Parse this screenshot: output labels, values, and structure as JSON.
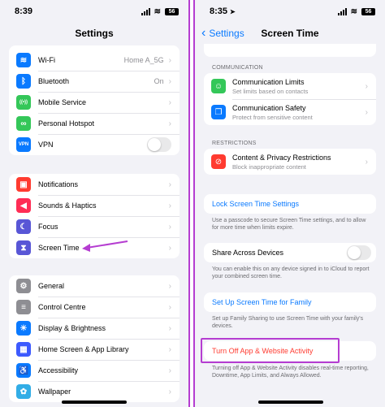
{
  "left": {
    "status_time": "8:39",
    "battery": "56",
    "title": "Settings",
    "group1": [
      {
        "label": "Wi-Fi",
        "value": "Home A_5G",
        "icon": "wifi-icon",
        "color": "#0a7aff",
        "glyph": "≋"
      },
      {
        "label": "Bluetooth",
        "value": "On",
        "icon": "bluetooth-icon",
        "color": "#0a7aff",
        "glyph": "ᛒ"
      },
      {
        "label": "Mobile Service",
        "value": "",
        "icon": "antenna-icon",
        "color": "#34c759",
        "glyph": "((•))"
      },
      {
        "label": "Personal Hotspot",
        "value": "",
        "icon": "hotspot-icon",
        "color": "#34c759",
        "glyph": "∞"
      },
      {
        "label": "VPN",
        "value": "",
        "icon": "vpn-icon",
        "color": "#0a7aff",
        "glyph": "VPN"
      }
    ],
    "group2": [
      {
        "label": "Notifications",
        "icon": "notifications-icon",
        "color": "#ff3b30",
        "glyph": "▣"
      },
      {
        "label": "Sounds & Haptics",
        "icon": "speaker-icon",
        "color": "#ff2d55",
        "glyph": "◀"
      },
      {
        "label": "Focus",
        "icon": "moon-icon",
        "color": "#5856d6",
        "glyph": "☾"
      },
      {
        "label": "Screen Time",
        "icon": "hourglass-icon",
        "color": "#5856d6",
        "glyph": "⧗"
      }
    ],
    "group3": [
      {
        "label": "General",
        "icon": "gear-icon",
        "color": "#8e8e93",
        "glyph": "⚙"
      },
      {
        "label": "Control Centre",
        "icon": "control-centre-icon",
        "color": "#8e8e93",
        "glyph": "≡"
      },
      {
        "label": "Display & Brightness",
        "icon": "sun-icon",
        "color": "#0a7aff",
        "glyph": "☀"
      },
      {
        "label": "Home Screen & App Library",
        "icon": "home-screen-icon",
        "color": "#3d5afe",
        "glyph": "▦"
      },
      {
        "label": "Accessibility",
        "icon": "accessibility-icon",
        "color": "#0a7aff",
        "glyph": "♿"
      },
      {
        "label": "Wallpaper",
        "icon": "wallpaper-icon",
        "color": "#32ade6",
        "glyph": "✿"
      }
    ]
  },
  "right": {
    "status_time": "8:35",
    "battery": "56",
    "back_label": "Settings",
    "title": "Screen Time",
    "communication_header": "COMMUNICATION",
    "communication": [
      {
        "title": "Communication Limits",
        "subtitle": "Set limits based on contacts",
        "icon": "contact-icon",
        "color": "#34c759",
        "glyph": "☺"
      },
      {
        "title": "Communication Safety",
        "subtitle": "Protect from sensitive content",
        "icon": "chat-bubble-icon",
        "color": "#0a7aff",
        "glyph": "❐"
      }
    ],
    "restrictions_header": "RESTRICTIONS",
    "restrictions": [
      {
        "title": "Content & Privacy Restrictions",
        "subtitle": "Block inappropriate content",
        "icon": "block-icon",
        "color": "#ff3b30",
        "glyph": "⊘"
      }
    ],
    "lock_label": "Lock Screen Time Settings",
    "lock_note": "Use a passcode to secure Screen Time settings, and to allow for more time when limits expire.",
    "share_label": "Share Across Devices",
    "share_note": "You can enable this on any device signed in to iCloud to report your combined screen time.",
    "family_label": "Set Up Screen Time for Family",
    "family_note": "Set up Family Sharing to use Screen Time with your family's devices.",
    "turn_off_label": "Turn Off App & Website Activity",
    "turn_off_note": "Turning off App & Website Activity disables real-time reporting, Downtime, App Limits, and Always Allowed."
  },
  "accent_colors": {
    "highlight": "#b53dd1",
    "link": "#0a7aff",
    "destructive": "#ff3b30"
  }
}
